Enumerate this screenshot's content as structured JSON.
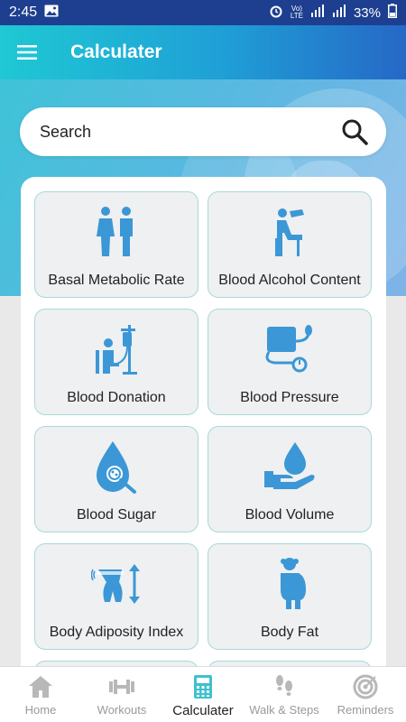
{
  "status_bar": {
    "time": "2:45",
    "battery": "33%",
    "network": "Vo) LTE"
  },
  "app_bar": {
    "title": "Calculater",
    "menu_icon": "hamburger-menu-icon"
  },
  "search": {
    "placeholder": "Search",
    "icon": "search-icon"
  },
  "calculators": [
    {
      "label": "Basal Metabolic Rate",
      "icon": "people-icon"
    },
    {
      "label": "Blood Alcohol Content",
      "icon": "drinking-person-icon"
    },
    {
      "label": "Blood Donation",
      "icon": "blood-donation-icon"
    },
    {
      "label": "Blood Pressure",
      "icon": "blood-pressure-icon"
    },
    {
      "label": "Blood Sugar",
      "icon": "blood-sugar-drop-icon"
    },
    {
      "label": "Blood Volume",
      "icon": "blood-volume-hand-icon"
    },
    {
      "label": "Body Adiposity Index",
      "icon": "waist-measure-icon"
    },
    {
      "label": "Body Fat",
      "icon": "body-fat-icon"
    }
  ],
  "bottom_nav": [
    {
      "label": "Home",
      "icon": "home-icon",
      "active": false
    },
    {
      "label": "Workouts",
      "icon": "dumbbell-icon",
      "active": false
    },
    {
      "label": "Calculater",
      "icon": "calculator-icon",
      "active": true
    },
    {
      "label": "Walk & Steps",
      "icon": "footsteps-icon",
      "active": false
    },
    {
      "label": "Reminders",
      "icon": "target-icon",
      "active": false
    }
  ],
  "colors": {
    "accent": "#2f95d6",
    "icon_blue": "#3b97d6",
    "tile_border": "#a8d8dc"
  }
}
